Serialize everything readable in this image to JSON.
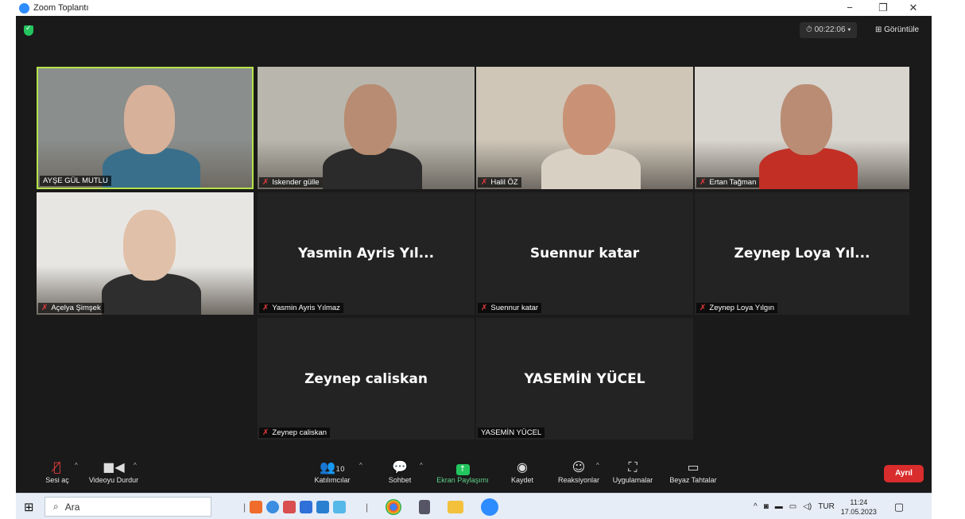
{
  "window": {
    "title": "Zoom Toplantı",
    "minimize": "−",
    "restore": "❐",
    "close": "✕"
  },
  "meeting": {
    "timer": "⏱ 00:22:06  ▾",
    "view_button": "⊞ Görüntüle"
  },
  "tiles": [
    {
      "name": "AYŞE GÜL MUTLU",
      "muted": false,
      "video": true,
      "active": true,
      "bg": "#8a8e8c",
      "skin": "#d8b19a",
      "top": "#3a6f8c"
    },
    {
      "name": "Iskender gülle",
      "muted": true,
      "video": true,
      "bg": "#b9b7ad",
      "skin": "#b88c72",
      "top": "#2b2b2b"
    },
    {
      "name": "Halil ÖZ",
      "muted": true,
      "video": true,
      "bg": "#cfc6b8",
      "skin": "#c99276",
      "top": "#d9d0c4"
    },
    {
      "name": "Ertan Tağman",
      "muted": true,
      "video": true,
      "bg": "#d8d4ce",
      "skin": "#b98c73",
      "top": "#c22f25"
    },
    {
      "name": "Açelya Şimşek",
      "muted": true,
      "video": true,
      "bg": "#e8e6e3",
      "skin": "#e0c0a8",
      "top": "#2e2e2e"
    },
    {
      "name": "Yasmin Ayris Yılmaz",
      "display": "Yasmin Ayris Yıl...",
      "muted": true,
      "video": false
    },
    {
      "name": "Suennur katar",
      "display": "Suennur katar",
      "muted": true,
      "video": false
    },
    {
      "name": "Zeynep Loya Yılgın",
      "display": "Zeynep Loya Yıl...",
      "muted": true,
      "video": false
    },
    {
      "name": "Zeynep caliskan",
      "display": "Zeynep caliskan",
      "muted": true,
      "video": false
    },
    {
      "name": "YASEMİN YÜCEL",
      "display": "YASEMİN YÜCEL",
      "muted": false,
      "video": false
    }
  ],
  "toolbar": {
    "mute": "Sesi aç",
    "video": "Videoyu Durdur",
    "participants": "Katılımcılar",
    "participants_count": "10",
    "chat": "Sohbet",
    "share": "Ekran Paylaşımı",
    "record": "Kaydet",
    "reactions": "Reaksiyonlar",
    "apps": "Uygulamalar",
    "whiteboards": "Beyaz Tahtalar",
    "leave": "Ayrıl"
  },
  "taskbar": {
    "search_placeholder": "Ara",
    "language": "TUR",
    "time": "11:24",
    "date": "17.05.2023"
  },
  "colors": {
    "active_border": "#b5e34a",
    "share_green": "#22c55e",
    "leave_red": "#d92c2c",
    "mute_red": "#e23b3b"
  }
}
